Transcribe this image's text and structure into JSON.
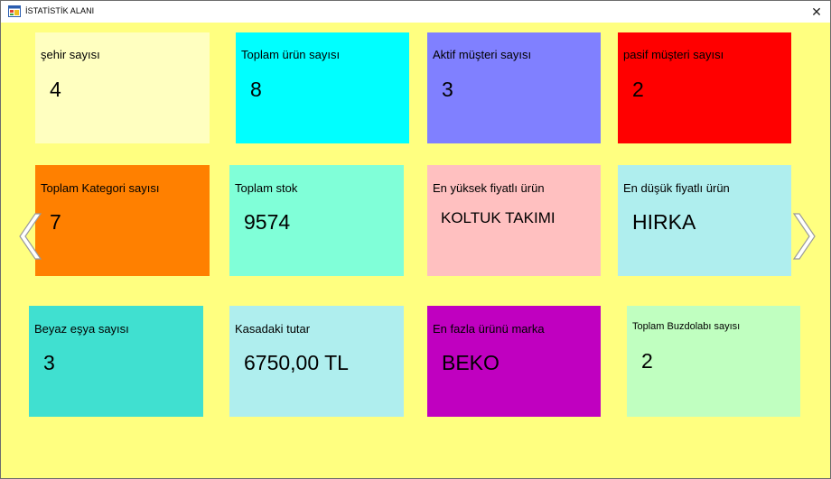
{
  "window": {
    "title": "İSTATİSTİK ALANI",
    "close_glyph": "✕"
  },
  "cards": [
    {
      "label": "şehir sayısı",
      "value": "4",
      "color": "#ffffc0"
    },
    {
      "label": "Toplam ürün sayısı",
      "value": "8",
      "color": "#00ffff"
    },
    {
      "label": "Aktif müşteri sayısı",
      "value": "3",
      "color": "#8080ff"
    },
    {
      "label": "pasif müşteri sayısı",
      "value": "2",
      "color": "#ff0000"
    },
    {
      "label": "Toplam Kategori sayısı",
      "value": "7",
      "color": "#ff8000"
    },
    {
      "label": "Toplam stok",
      "value": "9574",
      "color": "#80ffd8"
    },
    {
      "label": "En yüksek fiyatlı ürün",
      "value": "KOLTUK TAKIMI",
      "color": "#ffc0c0"
    },
    {
      "label": "En düşük fiyatlı ürün",
      "value": "HIRKA",
      "color": "#afeeee"
    },
    {
      "label": "Beyaz eşya sayısı",
      "value": "3",
      "color": "#40e0d0"
    },
    {
      "label": "Kasadaki tutar",
      "value": "6750,00 TL",
      "color": "#afeeee"
    },
    {
      "label": "En fazla ürünü marka",
      "value": "BEKO",
      "color": "#c000c0"
    },
    {
      "label": "Toplam Buzdolabı sayısı",
      "value": "2",
      "color": "#c0ffc0"
    }
  ],
  "nav": {
    "prev_icon": "chevron-left-icon",
    "next_icon": "chevron-right-icon"
  },
  "background_color": "#ffff80"
}
